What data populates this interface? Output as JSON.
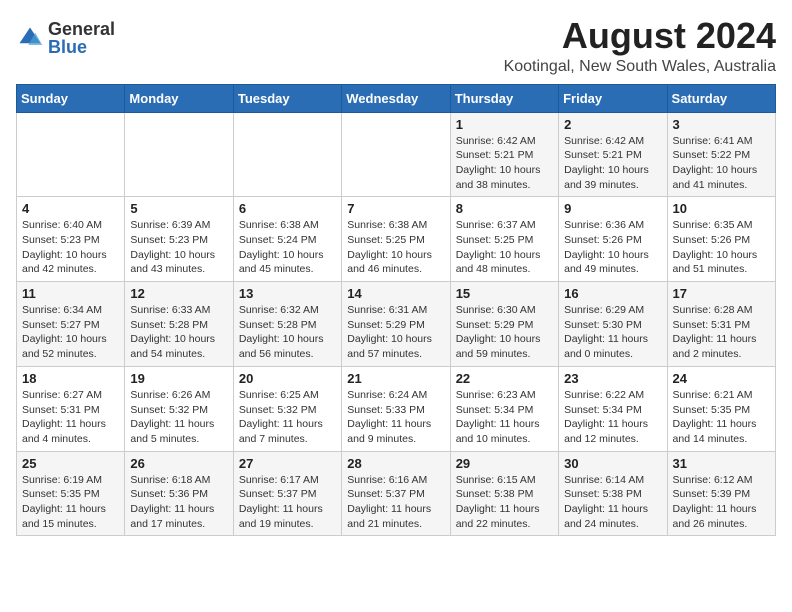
{
  "logo": {
    "general": "General",
    "blue": "Blue"
  },
  "title": "August 2024",
  "location": "Kootingal, New South Wales, Australia",
  "weekdays": [
    "Sunday",
    "Monday",
    "Tuesday",
    "Wednesday",
    "Thursday",
    "Friday",
    "Saturday"
  ],
  "weeks": [
    [
      {
        "day": "",
        "info": ""
      },
      {
        "day": "",
        "info": ""
      },
      {
        "day": "",
        "info": ""
      },
      {
        "day": "",
        "info": ""
      },
      {
        "day": "1",
        "info": "Sunrise: 6:42 AM\nSunset: 5:21 PM\nDaylight: 10 hours\nand 38 minutes."
      },
      {
        "day": "2",
        "info": "Sunrise: 6:42 AM\nSunset: 5:21 PM\nDaylight: 10 hours\nand 39 minutes."
      },
      {
        "day": "3",
        "info": "Sunrise: 6:41 AM\nSunset: 5:22 PM\nDaylight: 10 hours\nand 41 minutes."
      }
    ],
    [
      {
        "day": "4",
        "info": "Sunrise: 6:40 AM\nSunset: 5:23 PM\nDaylight: 10 hours\nand 42 minutes."
      },
      {
        "day": "5",
        "info": "Sunrise: 6:39 AM\nSunset: 5:23 PM\nDaylight: 10 hours\nand 43 minutes."
      },
      {
        "day": "6",
        "info": "Sunrise: 6:38 AM\nSunset: 5:24 PM\nDaylight: 10 hours\nand 45 minutes."
      },
      {
        "day": "7",
        "info": "Sunrise: 6:38 AM\nSunset: 5:25 PM\nDaylight: 10 hours\nand 46 minutes."
      },
      {
        "day": "8",
        "info": "Sunrise: 6:37 AM\nSunset: 5:25 PM\nDaylight: 10 hours\nand 48 minutes."
      },
      {
        "day": "9",
        "info": "Sunrise: 6:36 AM\nSunset: 5:26 PM\nDaylight: 10 hours\nand 49 minutes."
      },
      {
        "day": "10",
        "info": "Sunrise: 6:35 AM\nSunset: 5:26 PM\nDaylight: 10 hours\nand 51 minutes."
      }
    ],
    [
      {
        "day": "11",
        "info": "Sunrise: 6:34 AM\nSunset: 5:27 PM\nDaylight: 10 hours\nand 52 minutes."
      },
      {
        "day": "12",
        "info": "Sunrise: 6:33 AM\nSunset: 5:28 PM\nDaylight: 10 hours\nand 54 minutes."
      },
      {
        "day": "13",
        "info": "Sunrise: 6:32 AM\nSunset: 5:28 PM\nDaylight: 10 hours\nand 56 minutes."
      },
      {
        "day": "14",
        "info": "Sunrise: 6:31 AM\nSunset: 5:29 PM\nDaylight: 10 hours\nand 57 minutes."
      },
      {
        "day": "15",
        "info": "Sunrise: 6:30 AM\nSunset: 5:29 PM\nDaylight: 10 hours\nand 59 minutes."
      },
      {
        "day": "16",
        "info": "Sunrise: 6:29 AM\nSunset: 5:30 PM\nDaylight: 11 hours\nand 0 minutes."
      },
      {
        "day": "17",
        "info": "Sunrise: 6:28 AM\nSunset: 5:31 PM\nDaylight: 11 hours\nand 2 minutes."
      }
    ],
    [
      {
        "day": "18",
        "info": "Sunrise: 6:27 AM\nSunset: 5:31 PM\nDaylight: 11 hours\nand 4 minutes."
      },
      {
        "day": "19",
        "info": "Sunrise: 6:26 AM\nSunset: 5:32 PM\nDaylight: 11 hours\nand 5 minutes."
      },
      {
        "day": "20",
        "info": "Sunrise: 6:25 AM\nSunset: 5:32 PM\nDaylight: 11 hours\nand 7 minutes."
      },
      {
        "day": "21",
        "info": "Sunrise: 6:24 AM\nSunset: 5:33 PM\nDaylight: 11 hours\nand 9 minutes."
      },
      {
        "day": "22",
        "info": "Sunrise: 6:23 AM\nSunset: 5:34 PM\nDaylight: 11 hours\nand 10 minutes."
      },
      {
        "day": "23",
        "info": "Sunrise: 6:22 AM\nSunset: 5:34 PM\nDaylight: 11 hours\nand 12 minutes."
      },
      {
        "day": "24",
        "info": "Sunrise: 6:21 AM\nSunset: 5:35 PM\nDaylight: 11 hours\nand 14 minutes."
      }
    ],
    [
      {
        "day": "25",
        "info": "Sunrise: 6:19 AM\nSunset: 5:35 PM\nDaylight: 11 hours\nand 15 minutes."
      },
      {
        "day": "26",
        "info": "Sunrise: 6:18 AM\nSunset: 5:36 PM\nDaylight: 11 hours\nand 17 minutes."
      },
      {
        "day": "27",
        "info": "Sunrise: 6:17 AM\nSunset: 5:37 PM\nDaylight: 11 hours\nand 19 minutes."
      },
      {
        "day": "28",
        "info": "Sunrise: 6:16 AM\nSunset: 5:37 PM\nDaylight: 11 hours\nand 21 minutes."
      },
      {
        "day": "29",
        "info": "Sunrise: 6:15 AM\nSunset: 5:38 PM\nDaylight: 11 hours\nand 22 minutes."
      },
      {
        "day": "30",
        "info": "Sunrise: 6:14 AM\nSunset: 5:38 PM\nDaylight: 11 hours\nand 24 minutes."
      },
      {
        "day": "31",
        "info": "Sunrise: 6:12 AM\nSunset: 5:39 PM\nDaylight: 11 hours\nand 26 minutes."
      }
    ]
  ]
}
